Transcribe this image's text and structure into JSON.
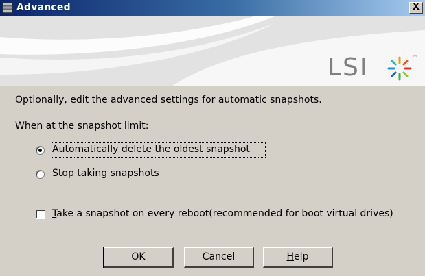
{
  "window": {
    "title": "Advanced",
    "close_label": "X"
  },
  "banner": {
    "logo_text": "LSI"
  },
  "content": {
    "intro": "Optionally, edit the advanced settings for automatic snapshots.",
    "limit_label": "When at the snapshot limit:",
    "options": [
      {
        "label_pre": "",
        "label_key": "A",
        "label_post": "utomatically delete the oldest snapshot",
        "selected": true
      },
      {
        "label_pre": "St",
        "label_key": "o",
        "label_post": "p taking snapshots",
        "selected": false
      }
    ],
    "reboot_checkbox": {
      "label_key": "T",
      "label_post": "ake a snapshot on every reboot(recommended for boot virtual drives)",
      "checked": false
    }
  },
  "buttons": {
    "ok": "OK",
    "cancel": "Cancel",
    "help_key": "H",
    "help_post": "elp"
  }
}
